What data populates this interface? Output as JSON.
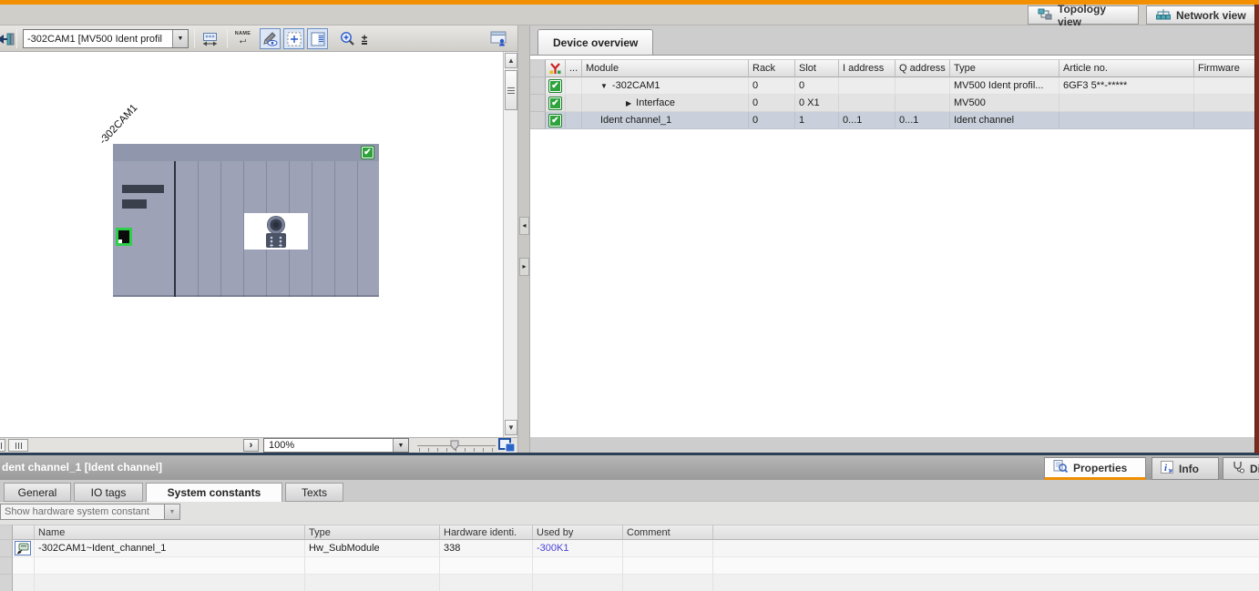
{
  "colors": {
    "accent_orange": "#F39000",
    "tab_accent_orange": "#EE8E00",
    "selection_row": "#C9D0DB",
    "status_green": "#2EA23B",
    "link_blue": "#4A43D9",
    "module_body": "#9DA2B6",
    "separator_navy": "#2B4055",
    "edge_stripe_maroon": "#7C2B1E"
  },
  "top": {
    "topology_tab": "Topology view",
    "network_tab": "Network view"
  },
  "device_view": {
    "selector_value": "-302CAM1 [MV500 Ident profil",
    "name_icon_text": "NAME",
    "device_label": "-302CAM1",
    "zoom_value": "100%"
  },
  "device_overview": {
    "tab_label": "Device overview",
    "dots_header": "...",
    "columns": [
      "Module",
      "Rack",
      "Slot",
      "I address",
      "Q address",
      "Type",
      "Article no.",
      "Firmware"
    ],
    "rows": [
      {
        "module": "-302CAM1",
        "rack": "0",
        "slot": "0",
        "i_address": "",
        "q_address": "",
        "type": "MV500 Ident profil...",
        "article_no": "6GF3 5**-*****",
        "firmware": ""
      },
      {
        "module": "Interface",
        "rack": "0",
        "slot": "0 X1",
        "i_address": "",
        "q_address": "",
        "type": "MV500",
        "article_no": "",
        "firmware": ""
      },
      {
        "module": "Ident channel_1",
        "rack": "0",
        "slot": "1",
        "i_address": "0...1",
        "q_address": "0...1",
        "type": "Ident channel",
        "article_no": "",
        "firmware": ""
      }
    ]
  },
  "inspector": {
    "title": "dent channel_1 [Ident channel]",
    "tab_properties": "Properties",
    "tab_info": "Info",
    "tab_diagnostics": "Dia",
    "subtabs": [
      "General",
      "IO tags",
      "System constants",
      "Texts"
    ],
    "filter_value": "Show hardware system constant",
    "columns": [
      "Name",
      "Type",
      "Hardware identi.",
      "Used by",
      "Comment"
    ],
    "rows": [
      {
        "name": "-302CAM1~Ident_channel_1",
        "type": "Hw_SubModule",
        "hardware_id": "338",
        "used_by": "-300K1",
        "comment": ""
      }
    ]
  }
}
